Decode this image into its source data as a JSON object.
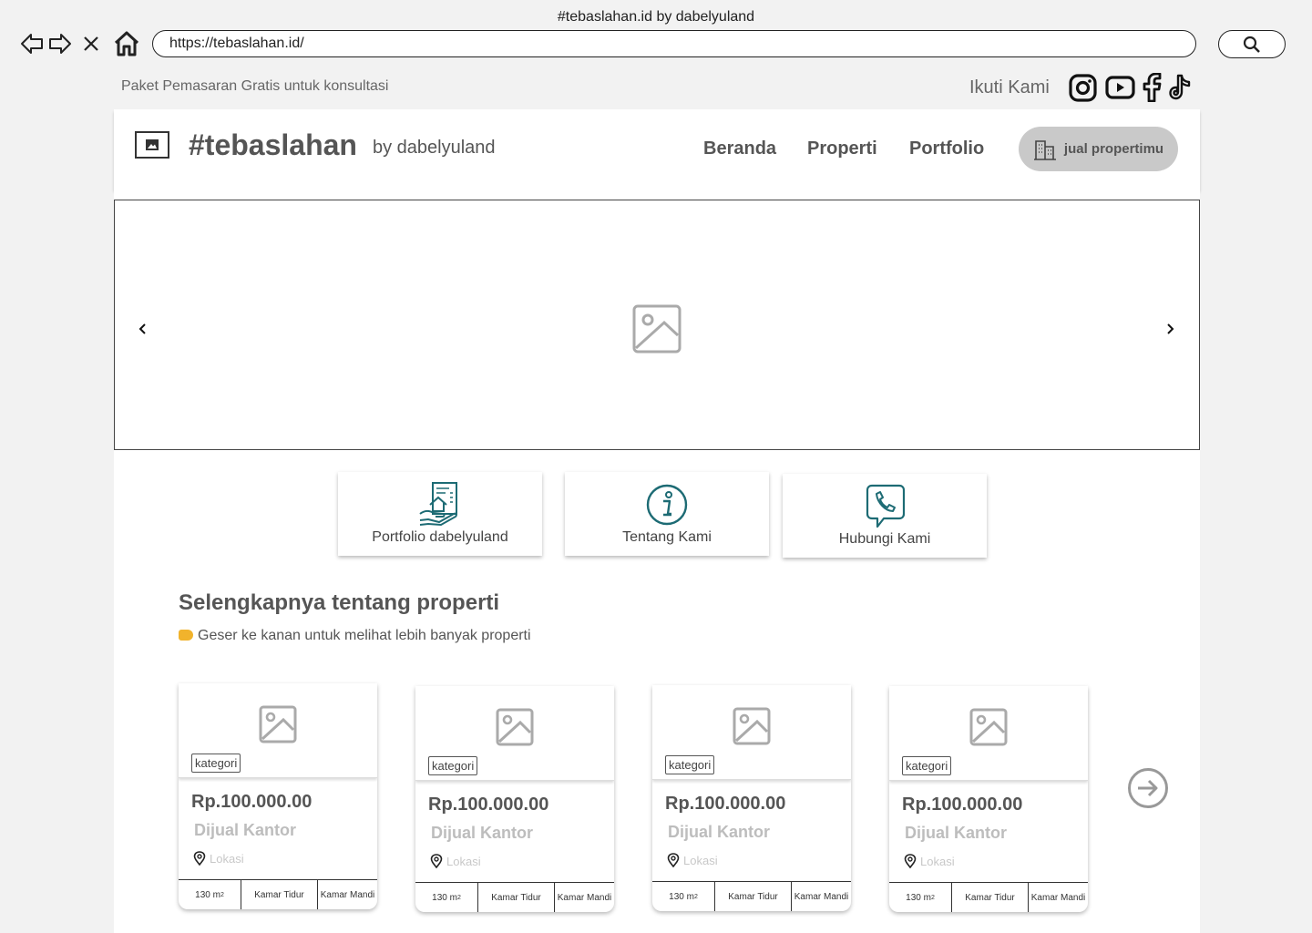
{
  "window": {
    "title": "#tebaslahan.id by dabelyuland"
  },
  "browser": {
    "url": "https://tebaslahan.id/",
    "icons": [
      "back-icon",
      "forward-icon",
      "close-icon",
      "home-icon",
      "search-icon"
    ]
  },
  "topbar": {
    "promo": "Paket Pemasaran Gratis untuk konsultasi",
    "follow_label": "Ikuti Kami",
    "social_icons": [
      "instagram-icon",
      "youtube-icon",
      "facebook-icon",
      "tiktok-icon"
    ]
  },
  "header": {
    "brand": "#tebaslahan",
    "brand_sub": "by dabelyuland",
    "menu": [
      "Beranda",
      "Properti",
      "Portfolio"
    ],
    "cta": "jual propertimu"
  },
  "quick_links": [
    {
      "label": "Portfolio dabelyuland",
      "icon": "house-document-icon"
    },
    {
      "label": "Tentang Kami",
      "icon": "info-icon"
    },
    {
      "label": "Hubungi Kami",
      "icon": "phone-chat-icon"
    }
  ],
  "section": {
    "title": "Selengkapnya tentang properti",
    "hint": "Geser ke kanan untuk melihat lebih banyak properti"
  },
  "properties": [
    {
      "category": "kategori",
      "price": "Rp.100.000.00",
      "type": "Dijual Kantor",
      "location": "Lokasi",
      "area": "130 m",
      "area_unit_sup": "2",
      "bedrooms": "Kamar Tidur",
      "bathrooms": "Kamar Mandi"
    },
    {
      "category": "kategori",
      "price": "Rp.100.000.00",
      "type": "Dijual Kantor",
      "location": "Lokasi",
      "area": "130 m",
      "area_unit_sup": "2",
      "bedrooms": "Kamar Tidur",
      "bathrooms": "Kamar Mandi"
    },
    {
      "category": "kategori",
      "price": "Rp.100.000.00",
      "type": "Dijual Kantor",
      "location": "Lokasi",
      "area": "130 m",
      "area_unit_sup": "2",
      "bedrooms": "Kamar Tidur",
      "bathrooms": "Kamar Mandi"
    },
    {
      "category": "kategori",
      "price": "Rp.100.000.00",
      "type": "Dijual Kantor",
      "location": "Lokasi",
      "area": "130 m",
      "area_unit_sup": "2",
      "bedrooms": "Kamar Tidur",
      "bathrooms": "Kamar Mandi"
    }
  ],
  "colors": {
    "accent_teal": "#1d6b74",
    "button_gray": "#c9c9c9",
    "text_gray": "#555555"
  }
}
